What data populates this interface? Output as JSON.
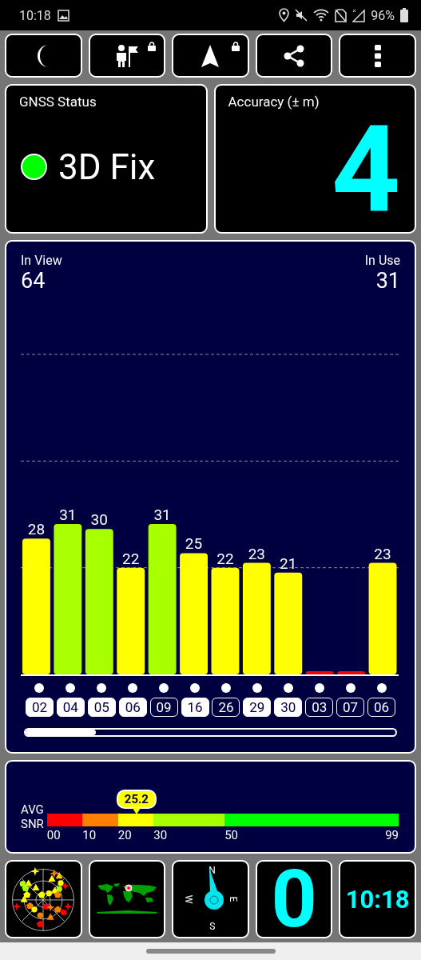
{
  "status_bar": {
    "time": "10:18",
    "battery": "96%"
  },
  "toolbar": [
    {
      "kind": "night",
      "locked": false
    },
    {
      "kind": "person",
      "locked": true
    },
    {
      "kind": "navigate",
      "locked": true
    },
    {
      "kind": "share",
      "locked": false
    },
    {
      "kind": "menu",
      "locked": false
    }
  ],
  "gnss_status": {
    "title": "GNSS Status",
    "fix": "3D Fix",
    "color": "#00ff00"
  },
  "accuracy": {
    "title": "Accuracy (± m)",
    "value": "4"
  },
  "satellites": {
    "in_view_label": "In View",
    "in_view": "64",
    "in_use_label": "In Use",
    "in_use": "31",
    "chart_data": {
      "type": "bar",
      "categories": [
        "02",
        "04",
        "05",
        "06",
        "09",
        "16",
        "26",
        "29",
        "30",
        "03",
        "07",
        "06"
      ],
      "values": [
        28,
        31,
        30,
        22,
        31,
        25,
        22,
        23,
        21,
        0,
        0,
        23
      ],
      "value_labels": [
        "28",
        "31",
        "30",
        "22",
        "31",
        "25",
        "22",
        "23",
        "21",
        null,
        null,
        "23"
      ]
    },
    "used_in_fix": [
      true,
      true,
      true,
      true,
      false,
      true,
      false,
      true,
      true,
      false,
      false,
      false
    ]
  },
  "snr": {
    "label_1": "AVG",
    "label_2": "SNR",
    "value": "25.2",
    "segments": [
      {
        "tick": "00",
        "color": "#ff0000"
      },
      {
        "tick": "10",
        "color": "#ff8000"
      },
      {
        "tick": "20",
        "color": "#ffff00"
      },
      {
        "tick": "30",
        "color": "#a8ff00"
      },
      {
        "tick": "50",
        "color": "#00ff00"
      }
    ],
    "end_tick": "99"
  },
  "tiles": [
    {
      "kind": "sky_plot"
    },
    {
      "kind": "world_map"
    },
    {
      "kind": "compass",
      "n": "N",
      "e": "E",
      "s": "S",
      "w": "W"
    },
    {
      "kind": "speed",
      "value": "0"
    },
    {
      "kind": "clock",
      "value": "10:18"
    }
  ]
}
